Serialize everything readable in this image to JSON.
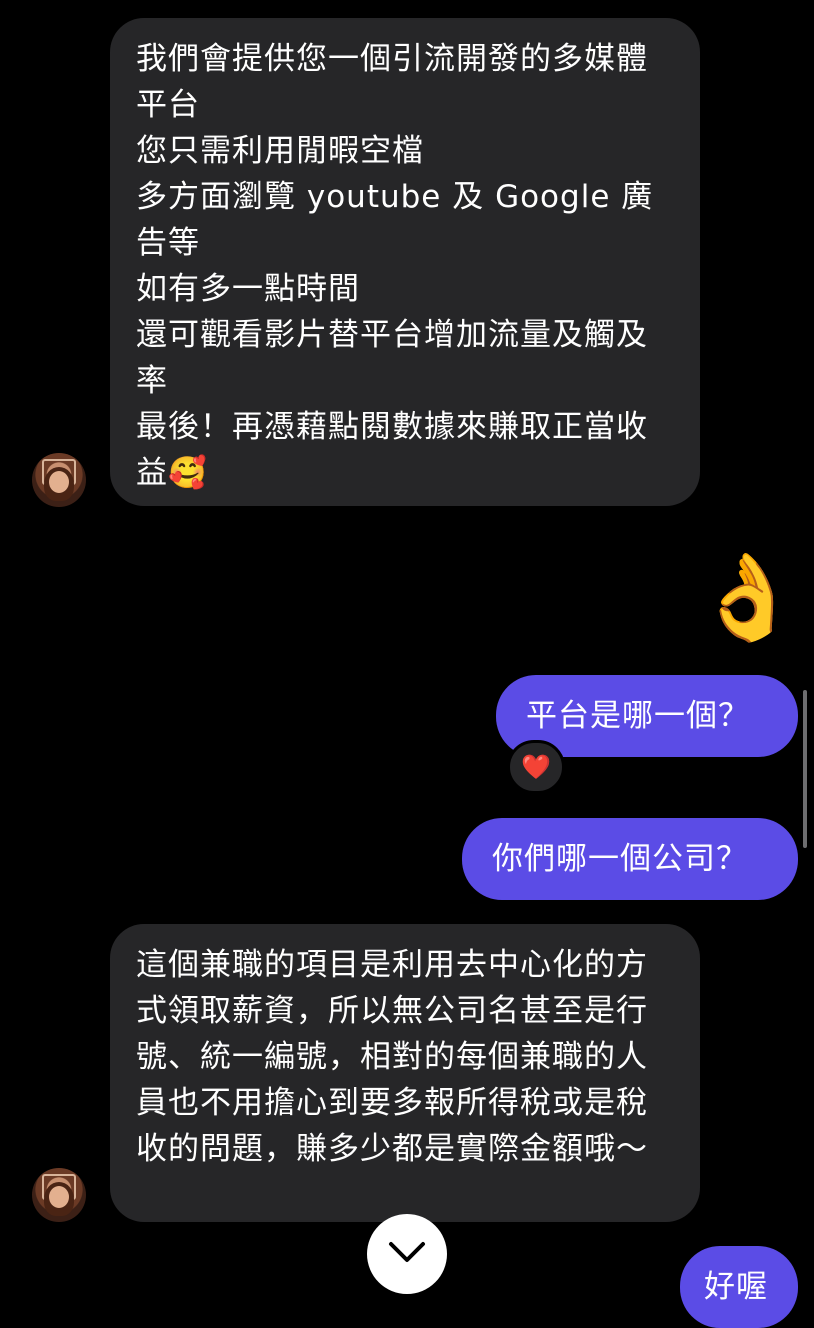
{
  "messages": {
    "incoming_1": {
      "lines": [
        "我們會提供您一個引流開發的多媒體平台",
        "您只需利用閒暇空檔",
        "多方面瀏覽 youtube 及 Google 廣告等",
        "如有多一點時間",
        "還可觀看影片替平台增加流量及觸及率",
        "最後！再憑藉點閱數據來賺取正當收益🥰"
      ]
    },
    "outgoing_ok_emoji": "👌",
    "outgoing_1": "平台是哪一個？",
    "outgoing_1_reaction": "❤️",
    "outgoing_2": "你們哪一個公司？",
    "incoming_2": {
      "text": "這個兼職的項目是利用去中心化的方式領取薪資，所以無公司名甚至是行號、統一編號，相對的每個兼職的人員也不用擔心到要多報所得稅或是稅收的問題，賺多少都是實際金額哦～"
    },
    "outgoing_3_partial": "好喔"
  },
  "icons": {
    "scroll_down": "chevron-down-icon",
    "avatar": "avatar"
  },
  "colors": {
    "background": "#000000",
    "incoming_bubble": "#262628",
    "outgoing_bubble": "#5b4ce6",
    "text": "#ffffff"
  }
}
